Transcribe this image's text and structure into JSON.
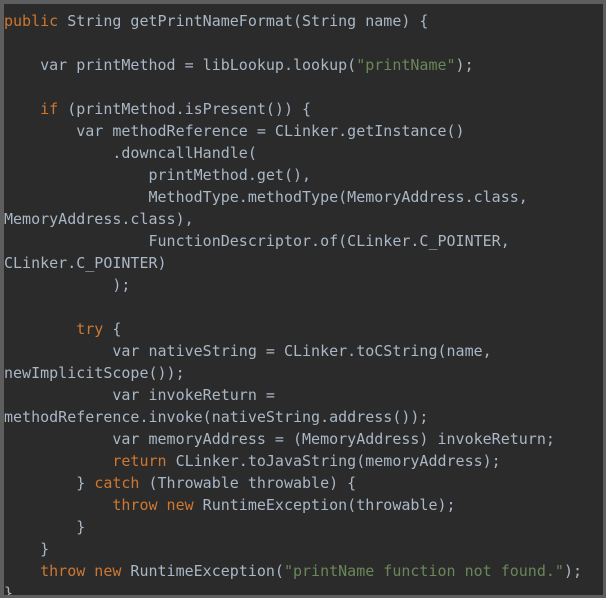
{
  "editor": {
    "language": "Java",
    "background_color": "#2b2b2b",
    "frame_color": "#5e5e5e",
    "default_text_color": "#a9b7c6",
    "keyword_color": "#cc7832",
    "string_color": "#6a8759",
    "font_size_px": 15,
    "line_height_px": 22,
    "wrap_enabled": true
  },
  "code": {
    "title": "getPrintNameFormat",
    "lines": [
      {
        "id": "l1",
        "segments": [
          {
            "t": "public",
            "c": "kw"
          },
          {
            "t": " String getPrintNameFormat(String name) {",
            "c": "plain"
          }
        ]
      },
      {
        "id": "l2",
        "segments": [
          {
            "t": "",
            "c": "plain"
          }
        ]
      },
      {
        "id": "l3",
        "segments": [
          {
            "t": "    var printMethod = libLookup.lookup(",
            "c": "plain"
          },
          {
            "t": "\"printName\"",
            "c": "str"
          },
          {
            "t": ");",
            "c": "plain"
          }
        ]
      },
      {
        "id": "l4",
        "segments": [
          {
            "t": "",
            "c": "plain"
          }
        ]
      },
      {
        "id": "l5",
        "segments": [
          {
            "t": "    ",
            "c": "plain"
          },
          {
            "t": "if",
            "c": "kw"
          },
          {
            "t": " (printMethod.isPresent()) {",
            "c": "plain"
          }
        ]
      },
      {
        "id": "l6",
        "segments": [
          {
            "t": "        var methodReference = CLinker.getInstance()",
            "c": "plain"
          }
        ]
      },
      {
        "id": "l7",
        "segments": [
          {
            "t": "            .downcallHandle(",
            "c": "plain"
          }
        ]
      },
      {
        "id": "l8",
        "segments": [
          {
            "t": "                printMethod.get(),",
            "c": "plain"
          }
        ]
      },
      {
        "id": "l9",
        "segments": [
          {
            "t": "                MethodType.methodType(MemoryAddress.class,",
            "c": "plain"
          }
        ]
      },
      {
        "id": "l10",
        "segments": [
          {
            "t": "MemoryAddress.class),",
            "c": "plain"
          }
        ]
      },
      {
        "id": "l11",
        "segments": [
          {
            "t": "                FunctionDescriptor.of(CLinker.C_POINTER,",
            "c": "plain"
          }
        ]
      },
      {
        "id": "l12",
        "segments": [
          {
            "t": "CLinker.C_POINTER)",
            "c": "plain"
          }
        ]
      },
      {
        "id": "l13",
        "segments": [
          {
            "t": "            );",
            "c": "plain"
          }
        ]
      },
      {
        "id": "l14",
        "segments": [
          {
            "t": "",
            "c": "plain"
          }
        ]
      },
      {
        "id": "l15",
        "segments": [
          {
            "t": "        ",
            "c": "plain"
          },
          {
            "t": "try",
            "c": "kw"
          },
          {
            "t": " {",
            "c": "plain"
          }
        ]
      },
      {
        "id": "l16",
        "segments": [
          {
            "t": "            var nativeString = CLinker.toCString(name,",
            "c": "plain"
          }
        ]
      },
      {
        "id": "l17",
        "segments": [
          {
            "t": "newImplicitScope());",
            "c": "plain"
          }
        ]
      },
      {
        "id": "l18",
        "segments": [
          {
            "t": "            var invokeReturn =",
            "c": "plain"
          }
        ]
      },
      {
        "id": "l19",
        "segments": [
          {
            "t": "methodReference.invoke(nativeString.address());",
            "c": "plain"
          }
        ]
      },
      {
        "id": "l20",
        "segments": [
          {
            "t": "            var memoryAddress = (MemoryAddress) invokeReturn;",
            "c": "plain"
          }
        ]
      },
      {
        "id": "l21",
        "segments": [
          {
            "t": "            ",
            "c": "plain"
          },
          {
            "t": "return",
            "c": "kw"
          },
          {
            "t": " CLinker.toJavaString(memoryAddress);",
            "c": "plain"
          }
        ]
      },
      {
        "id": "l22",
        "segments": [
          {
            "t": "        } ",
            "c": "plain"
          },
          {
            "t": "catch",
            "c": "kw"
          },
          {
            "t": " (Throwable throwable) {",
            "c": "plain"
          }
        ]
      },
      {
        "id": "l23",
        "segments": [
          {
            "t": "            ",
            "c": "plain"
          },
          {
            "t": "throw new",
            "c": "kw"
          },
          {
            "t": " RuntimeException(throwable);",
            "c": "plain"
          }
        ]
      },
      {
        "id": "l24",
        "segments": [
          {
            "t": "        }",
            "c": "plain"
          }
        ]
      },
      {
        "id": "l25",
        "segments": [
          {
            "t": "    }",
            "c": "plain"
          }
        ]
      },
      {
        "id": "l26",
        "segments": [
          {
            "t": "    ",
            "c": "plain"
          },
          {
            "t": "throw new",
            "c": "kw"
          },
          {
            "t": " RuntimeException(",
            "c": "plain"
          },
          {
            "t": "\"printName function not found.\"",
            "c": "str"
          },
          {
            "t": ");",
            "c": "plain"
          }
        ]
      },
      {
        "id": "l27",
        "segments": [
          {
            "t": "}",
            "c": "plain"
          }
        ]
      }
    ]
  }
}
